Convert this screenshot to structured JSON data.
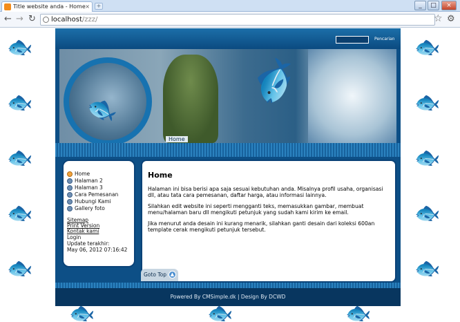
{
  "browser": {
    "tab_title": "Title website anda - Home",
    "tab_close": "×",
    "new_tab": "+",
    "url_host": "localhost",
    "url_path": "/zzz/",
    "min": "_",
    "max": "□",
    "close": "×",
    "back": "←",
    "forward": "→",
    "reload": "↻",
    "star": "☆",
    "wrench": "🔧"
  },
  "site": {
    "search_label": "Pencarian",
    "breadcrumb": "Home",
    "menu": [
      {
        "label": "Home",
        "active": true
      },
      {
        "label": "Halaman 2"
      },
      {
        "label": "Halaman 3"
      },
      {
        "label": "Cara Pemesanan"
      },
      {
        "label": "Hubungi Kami"
      },
      {
        "label": "Gallery foto"
      }
    ],
    "sitemap": "Sitemap",
    "print_version": "Print Version",
    "contact": "Kontak kami",
    "login": "Login",
    "update_label": "Update terakhir:",
    "update_date": "May 06, 2012 07:16:42",
    "content_title": "Home",
    "paragraphs": [
      "Halaman ini bisa berisi apa saja sesuai kebutuhan anda. Misalnya profil usaha, organisasi dll, atau tata cara pemesanan, daftar harga, atau informasi lainnya.",
      "Silahkan edit website ini seperti mengganti teks, memasukkan gambar, membuat menu/halaman baru dll mengikuti petunjuk yang sudah kami kirim ke email.",
      "Jika menurut anda desain ini kurang menarik, silahkan ganti desain dari koleksi 600an template cerak mengikuti petunjuk tersebut."
    ],
    "goto_top": "Goto Top",
    "footer": "Powered By CMSimple.dk | Design By DCWD"
  }
}
